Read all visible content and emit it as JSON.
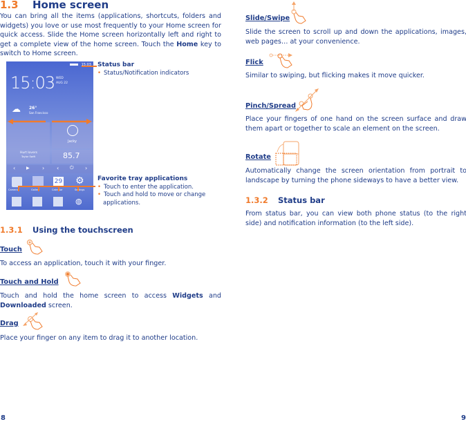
{
  "left_page": {
    "section": {
      "number": "1.3",
      "title": "Home screen"
    },
    "intro": {
      "before_bold": "You can bring all the items (applications, shortcuts, folders and widgets) you love or use most frequently to your Home screen for quick access. Slide the Home screen horizontally left and right to get a complete view of the home screen. Touch the ",
      "bold": "Home",
      "after_bold": " key to switch to Home screen."
    },
    "phone_screen": {
      "time": "15:03",
      "day": "WED",
      "date": "AUG 22",
      "status_time": "15:03",
      "temperature": "26°",
      "city": "San Francisco",
      "song": "Hurt lovers",
      "artist": "Taylor Swift",
      "contact": "Jacky",
      "radio": "85.7",
      "calendar_day": "29",
      "apps": [
        "Camera",
        "Gallery",
        "Calendar",
        "Settings"
      ],
      "tray_icons": [
        "phone-icon",
        "contacts-icon",
        "messaging-icon",
        "browser-icon"
      ]
    },
    "callouts": {
      "status_bar": {
        "title": "Status bar",
        "bullets": [
          "Status/Notification indicators"
        ]
      },
      "favorite_tray": {
        "title": "Favorite tray applications",
        "bullets": [
          "Touch to enter the application.",
          "Touch and hold to move or change applications."
        ]
      }
    },
    "subsection": {
      "number": "1.3.1",
      "title": "Using the touchscreen"
    },
    "gestures": [
      {
        "term": "Touch",
        "icon": "touch-gesture-icon",
        "text": "To access an application, touch it with your finger."
      },
      {
        "term": "Touch and Hold",
        "icon": "touch-hold-gesture-icon",
        "text_before": "Touch and hold the home screen to access ",
        "bold1": "Widgets",
        "text_mid": " and ",
        "bold2": "Downloaded",
        "text_after": " screen."
      },
      {
        "term": "Drag",
        "icon": "drag-gesture-icon",
        "text": "Place your finger on any item to drag it to another location."
      }
    ],
    "page_number": "8"
  },
  "right_page": {
    "gestures": [
      {
        "term": "Slide/Swipe",
        "icon": "swipe-gesture-icon",
        "text": "Slide the screen to scroll up and down the applications, images, web pages… at your convenience."
      },
      {
        "term": "Flick",
        "icon": "flick-gesture-icon",
        "text": "Similar to swiping, but flicking makes it move quicker."
      },
      {
        "term": "Pinch/Spread",
        "icon": "pinch-gesture-icon",
        "text": "Place your fingers of one hand on the screen surface and draw them apart or together to scale an element on the screen."
      },
      {
        "term": "Rotate",
        "icon": "rotate-gesture-icon",
        "text": "Automatically change the screen orientation from portrait to landscape by turning the phone sideways to have a better view."
      }
    ],
    "subsection": {
      "number": "1.3.2",
      "title": "Status bar"
    },
    "status_text": "From status bar, you can view both phone status (to the right side) and notification information (to the left side).",
    "page_number": "9"
  },
  "colors": {
    "heading_blue": "#1f3c88",
    "accent_orange": "#f07b2c"
  }
}
